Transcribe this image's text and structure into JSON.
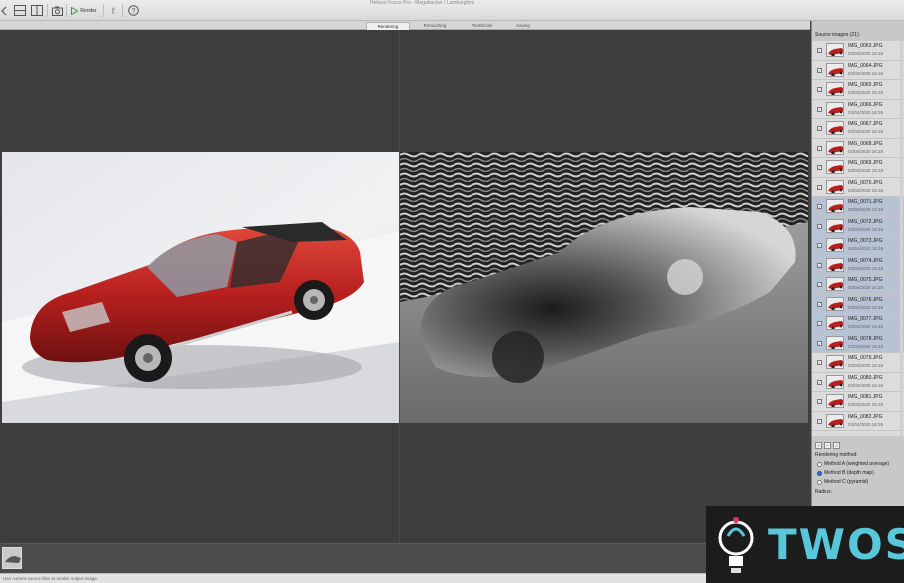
{
  "window": {
    "title": "Helicon Focus Pro - Megabucket / Lamborghini"
  },
  "toolbar": {
    "render_label": "Render"
  },
  "tabs": [
    {
      "label": "Rendering",
      "active": true
    },
    {
      "label": "Retouching",
      "active": false
    },
    {
      "label": "Text/Scale",
      "active": false
    },
    {
      "label": "Saving",
      "active": false
    }
  ],
  "sidebar": {
    "header": "Source images (21):",
    "items": [
      {
        "name": "IMG_0063.JPG",
        "date": "02/04/2020 16:18",
        "checked": true,
        "selected": false
      },
      {
        "name": "IMG_0064.JPG",
        "date": "02/04/2020 16:18",
        "checked": true,
        "selected": false
      },
      {
        "name": "IMG_0065.JPG",
        "date": "02/04/2020 16:18",
        "checked": true,
        "selected": false
      },
      {
        "name": "IMG_0066.JPG",
        "date": "02/04/2020 16:18",
        "checked": true,
        "selected": false
      },
      {
        "name": "IMG_0067.JPG",
        "date": "02/04/2020 16:18",
        "checked": true,
        "selected": false
      },
      {
        "name": "IMG_0068.JPG",
        "date": "02/04/2020 16:18",
        "checked": true,
        "selected": false
      },
      {
        "name": "IMG_0069.JPG",
        "date": "02/04/2020 16:18",
        "checked": true,
        "selected": false
      },
      {
        "name": "IMG_0070.JPG",
        "date": "02/04/2020 16:18",
        "checked": true,
        "selected": false
      },
      {
        "name": "IMG_0071.JPG",
        "date": "02/04/2020 16:18",
        "checked": true,
        "selected": true
      },
      {
        "name": "IMG_0072.JPG",
        "date": "02/04/2020 16:18",
        "checked": true,
        "selected": true
      },
      {
        "name": "IMG_0073.JPG",
        "date": "02/04/2020 16:18",
        "checked": true,
        "selected": true
      },
      {
        "name": "IMG_0074.JPG",
        "date": "02/04/2020 16:18",
        "checked": true,
        "selected": true
      },
      {
        "name": "IMG_0075.JPG",
        "date": "02/04/2020 16:18",
        "checked": true,
        "selected": true
      },
      {
        "name": "IMG_0076.JPG",
        "date": "02/04/2020 16:18",
        "checked": true,
        "selected": true
      },
      {
        "name": "IMG_0077.JPG",
        "date": "02/04/2020 16:18",
        "checked": true,
        "selected": true
      },
      {
        "name": "IMG_0078.JPG",
        "date": "02/04/2020 16:18",
        "checked": true,
        "selected": true
      },
      {
        "name": "IMG_0079.JPG",
        "date": "02/04/2020 16:18",
        "checked": true,
        "selected": false
      },
      {
        "name": "IMG_0080.JPG",
        "date": "02/04/2020 16:18",
        "checked": true,
        "selected": false
      },
      {
        "name": "IMG_0081.JPG",
        "date": "02/04/2020 16:18",
        "checked": true,
        "selected": false
      },
      {
        "name": "IMG_0082.JPG",
        "date": "02/04/2020 16:18",
        "checked": true,
        "selected": false
      }
    ],
    "rendering_method_label": "Rendering method:",
    "methods": [
      {
        "label": "Method A (weighted average)",
        "selected": false
      },
      {
        "label": "Method B (depth map)",
        "selected": true
      },
      {
        "label": "Method C (pyramid)",
        "selected": false
      }
    ],
    "radius_label": "Radius:"
  },
  "status": {
    "text": "Use current source files to render output image."
  },
  "watermark": {
    "text": "TWOS"
  },
  "colors": {
    "accent": "#57c7d9",
    "selection": "#b7c3d4",
    "car": "#b8201f"
  }
}
